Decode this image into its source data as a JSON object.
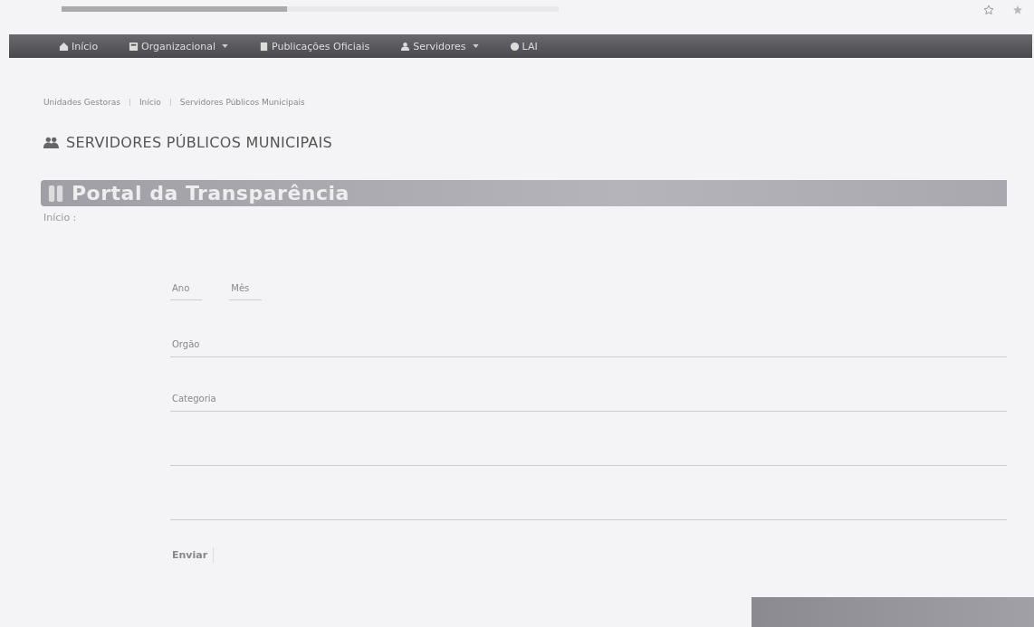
{
  "nav": {
    "items": [
      {
        "kind": "home",
        "label": "Início",
        "dropdown": false
      },
      {
        "kind": "building",
        "label": "Organizacional",
        "dropdown": true
      },
      {
        "kind": "book",
        "label": "Publicações Oficiais",
        "dropdown": false
      },
      {
        "kind": "user",
        "label": "Servidores",
        "dropdown": true
      },
      {
        "kind": "circle",
        "label": "LAI",
        "dropdown": false
      }
    ]
  },
  "breadcrumb": [
    "Unidades Gestoras",
    "Início",
    "Servidores Públicos Municipais"
  ],
  "heading": "SERVIDORES PÚBLICOS MUNICIPAIS",
  "banner": {
    "title": "Portal da Transparência"
  },
  "section_label": "Início :",
  "form": {
    "fields": [
      {
        "kind": "pair",
        "labels": [
          "Ano",
          "Mês"
        ]
      },
      {
        "kind": "line",
        "label": "Orgão"
      },
      {
        "kind": "line",
        "label": "Categoria"
      },
      {
        "kind": "blank"
      },
      {
        "kind": "blank"
      }
    ],
    "submit": "Enviar"
  }
}
